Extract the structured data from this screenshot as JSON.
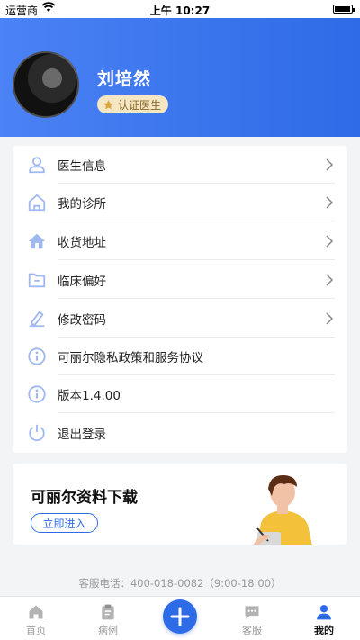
{
  "status_bar": {
    "carrier": "运营商",
    "time": "上午 10:27"
  },
  "profile": {
    "name": "刘培然",
    "badge": "认证医生"
  },
  "menu": [
    {
      "label": "医生信息",
      "icon": "user-icon",
      "arrow": true
    },
    {
      "label": "我的诊所",
      "icon": "clinic-icon",
      "arrow": true
    },
    {
      "label": "收货地址",
      "icon": "home-icon",
      "arrow": true
    },
    {
      "label": "临床偏好",
      "icon": "folder-icon",
      "arrow": true
    },
    {
      "label": "修改密码",
      "icon": "edit-icon",
      "arrow": true
    },
    {
      "label": "可丽尔隐私政策和服务协议",
      "icon": "info-icon",
      "arrow": false
    },
    {
      "label": "版本1.4.00",
      "icon": "info-icon",
      "arrow": false
    },
    {
      "label": "退出登录",
      "icon": "power-icon",
      "arrow": false
    }
  ],
  "promo": {
    "title": "可丽尔资料下载",
    "button": "立即进入"
  },
  "service_line": "客服电话：400-018-0082（9:00-18:00）",
  "tabbar": [
    {
      "label": "首页",
      "icon": "home-tab-icon",
      "active": false
    },
    {
      "label": "病例",
      "icon": "case-tab-icon",
      "active": false
    },
    {
      "label": "",
      "icon": "plus-icon",
      "active": false
    },
    {
      "label": "客服",
      "icon": "chat-tab-icon",
      "active": false
    },
    {
      "label": "我的",
      "icon": "profile-tab-icon",
      "active": true
    }
  ],
  "colors": {
    "primary": "#2e6be6",
    "icon_blue": "#9fb8ef",
    "badge_bg": "#f5e6c4"
  }
}
